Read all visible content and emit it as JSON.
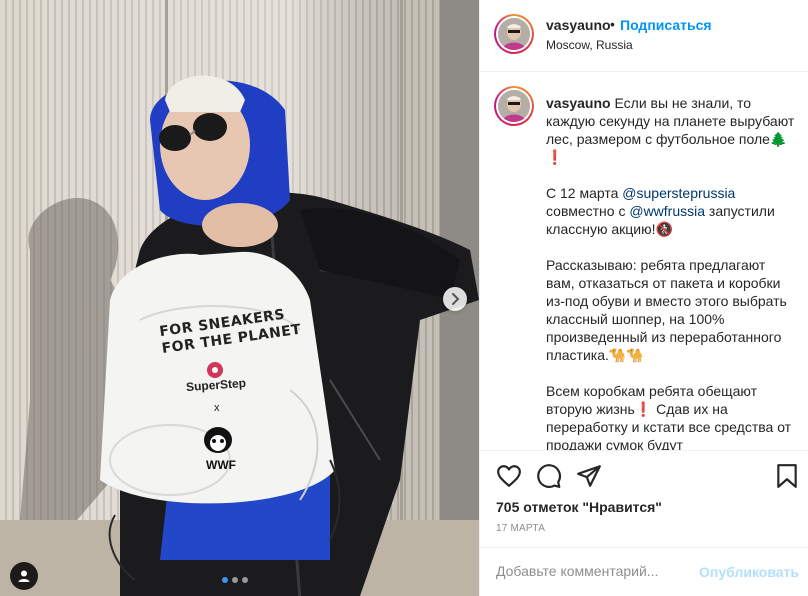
{
  "post": {
    "username": "vasyauno",
    "separator": "•",
    "follow_label": "Подписаться",
    "location": "Moscow, Russia"
  },
  "caption": {
    "username": "vasyauno",
    "p1": "Если вы не знали, то каждую секунду на планете вырубают лес, размером с футбольное поле🌲❗",
    "p2_before": "С 12 марта",
    "mention1": "@supersteprussia",
    "p2_mid": "совместно с",
    "mention2": "@wwfrussia",
    "p2_after": "запустили классную акцию!🚷",
    "p3": "Рассказываю: ребята предлагают вам, отказаться от пакета и коробки из-под обуви и вместо этого выбрать классный шоппер, на 100% произведенный из переработанного пластика.🐪🐪",
    "p4": "Всем коробкам ребята обещают вторую жизнь❗ Сдав их на переработку и кстати все средства от продажи сумок будут"
  },
  "bag": {
    "line1": "FOR SNEAKERS",
    "line2": "FOR THE PLANET",
    "brand": "SuperStep",
    "x": "x",
    "wwf": "WWF"
  },
  "stats": {
    "likes": "705 отметок \"Нравится\"",
    "date": "17 МАРТА"
  },
  "comment": {
    "placeholder": "Добавьте комментарий...",
    "publish_label": "Опубликовать"
  },
  "carousel": {
    "current": 1,
    "total": 3
  },
  "icons": {
    "like": "heart-icon",
    "comment": "comment-icon",
    "share": "share-icon",
    "save": "bookmark-icon",
    "next": "chevron-right-icon",
    "tags": "user-tag-icon"
  },
  "colors": {
    "link": "#0095f6",
    "mention": "#00376b",
    "muted": "#8e8e8e",
    "publish_disabled": "#b2dffc",
    "carousel_active": "#3897f0"
  }
}
